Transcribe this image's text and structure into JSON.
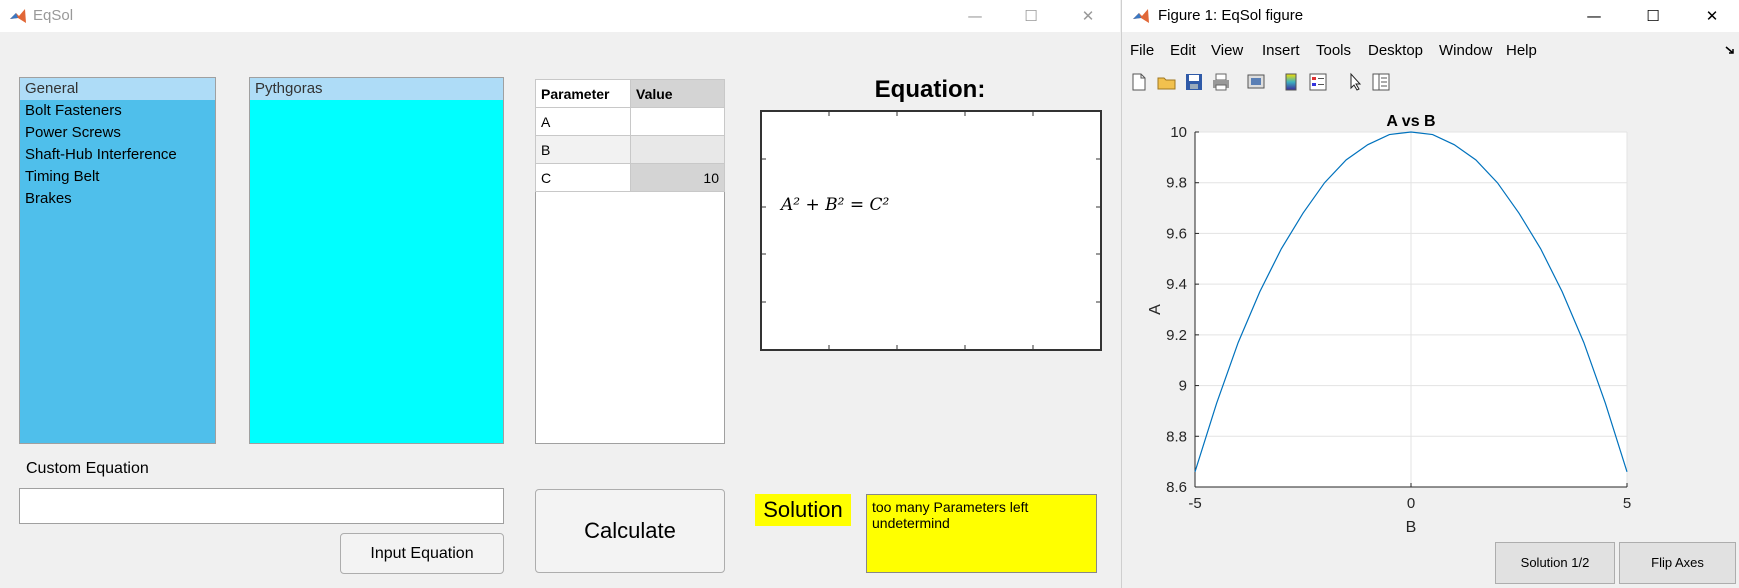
{
  "left_window": {
    "title": "EqSol",
    "controls": {
      "minimize": "—",
      "maximize": "☐",
      "close": "✕"
    },
    "categories": [
      "General",
      "Bolt Fasteners",
      "Power Screws",
      "Shaft-Hub Interference",
      "Timing Belt",
      "Brakes"
    ],
    "selected_category": "General",
    "equations": [
      "Pythgoras"
    ],
    "param_table": {
      "headers": [
        "Parameter",
        "Value"
      ],
      "rows": [
        {
          "name": "A",
          "value": ""
        },
        {
          "name": "B",
          "value": ""
        },
        {
          "name": "C",
          "value": "10"
        }
      ]
    },
    "equation_heading": "Equation:",
    "equation_text": "A² + B² = C²",
    "custom_equation_label": "Custom Equation",
    "custom_equation_value": "",
    "input_equation_button": "Input Equation",
    "calculate_button": "Calculate",
    "solution_label": "Solution",
    "solution_text": "too many Parameters left undetermind",
    "colors": {
      "category_bg": "#4fbfeb",
      "equations_bg": "#00ffff",
      "selected_bg": "#aedcf7",
      "solution_bg": "#ffff00"
    }
  },
  "right_window": {
    "title": "Figure 1: EqSol figure",
    "controls": {
      "minimize": "—",
      "maximize": "☐",
      "close": "✕"
    },
    "menu": [
      "File",
      "Edit",
      "View",
      "Insert",
      "Tools",
      "Desktop",
      "Window",
      "Help"
    ],
    "toolbar_icons": [
      "new-file-icon",
      "open-folder-icon",
      "save-icon",
      "print-icon",
      "print-preview-icon",
      "colorbar-icon",
      "legend-icon",
      "pointer-icon",
      "property-editor-icon"
    ],
    "solution_button": "Solution 1/2",
    "flip_axes_button": "Flip Axes"
  },
  "chart_data": {
    "type": "line",
    "title": "A vs B",
    "xlabel": "B",
    "ylabel": "A",
    "xlim": [
      -5,
      5
    ],
    "ylim": [
      8.6,
      10
    ],
    "xticks": [
      "-5",
      "0",
      "5"
    ],
    "yticks": [
      "8.6",
      "8.8",
      "9",
      "9.2",
      "9.4",
      "9.6",
      "9.8",
      "10"
    ],
    "grid": true,
    "series": [
      {
        "color": "#0072bd",
        "x": [
          -5,
          -4.5,
          -4,
          -3.5,
          -3,
          -2.5,
          -2,
          -1.5,
          -1,
          -0.5,
          0,
          0.5,
          1,
          1.5,
          2,
          2.5,
          3,
          3.5,
          4,
          4.5,
          5
        ],
        "y": [
          8.66,
          8.93,
          9.17,
          9.37,
          9.54,
          9.68,
          9.8,
          9.89,
          9.95,
          9.99,
          10.0,
          9.99,
          9.95,
          9.89,
          9.8,
          9.68,
          9.54,
          9.37,
          9.17,
          8.93,
          8.66
        ]
      }
    ]
  }
}
